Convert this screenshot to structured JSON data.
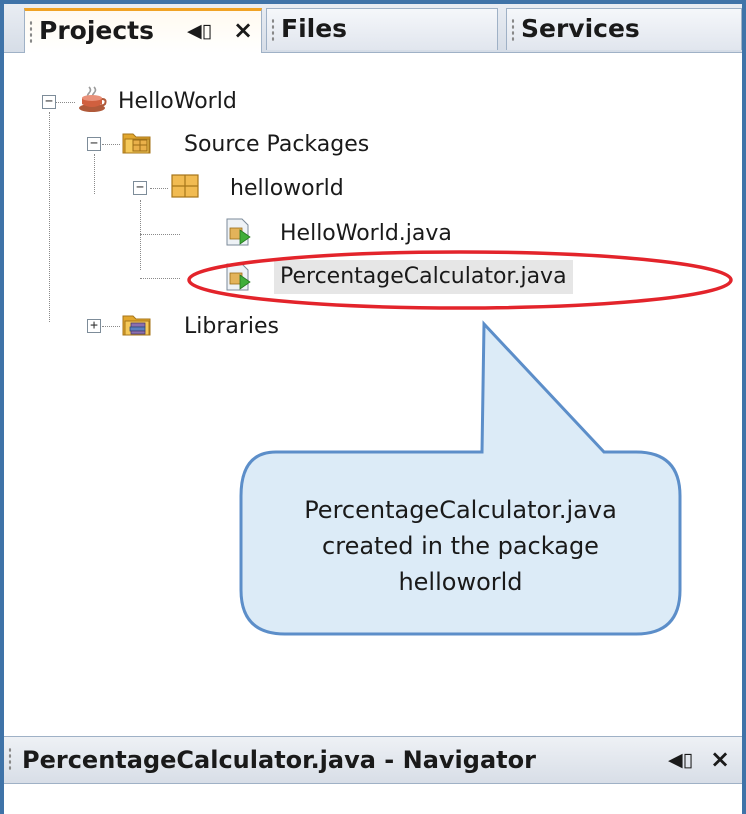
{
  "tabs": [
    {
      "label": "Projects",
      "active": true,
      "pin_glyph": "◀▯",
      "close_glyph": "×"
    },
    {
      "label": "Files",
      "active": false
    },
    {
      "label": "Services",
      "active": false
    }
  ],
  "tree": {
    "project": "HelloWorld",
    "source_packages": "Source Packages",
    "package": "helloworld",
    "file1": "HelloWorld.java",
    "file2": "PercentageCalculator.java",
    "libraries": "Libraries"
  },
  "callout": {
    "line1": "PercentageCalculator.java",
    "line2": "created in the package",
    "line3": "helloworld",
    "fill": "#dcebf7",
    "stroke": "#5c8ec9"
  },
  "highlight_color": "#e3242b",
  "navigator": {
    "title": "PercentageCalculator.java - Navigator",
    "pin_glyph": "◀▯",
    "close_glyph": "×"
  },
  "icons": {
    "project": "coffee-cup-icon",
    "source_packages": "folder-icon",
    "package": "package-icon",
    "java_file": "java-file-icon",
    "libraries": "library-folder-icon"
  }
}
